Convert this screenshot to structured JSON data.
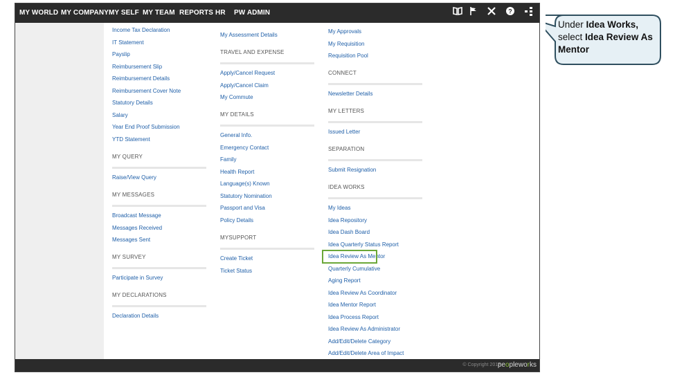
{
  "nav": {
    "items": [
      "MY WORLD",
      "MY COMPANY",
      "MY SELF",
      "MY TEAM",
      "REPORTS",
      "HR",
      "PW ADMIN"
    ],
    "icons": [
      "book-icon",
      "flag-icon",
      "tools-icon",
      "help-icon",
      "menu-dots-icon"
    ]
  },
  "col1": {
    "links_a": [
      "Income Tax Declaration",
      "IT Statement",
      "Payslip",
      "Reimbursement Slip",
      "Reimbursement Details",
      "Reimbursement Cover Note",
      "Statutory Details",
      "Salary",
      "Year End Proof Submission",
      "YTD Statement"
    ],
    "sec_query": "MY QUERY",
    "links_query": [
      "Raise/View Query"
    ],
    "sec_messages": "MY MESSAGES",
    "links_messages": [
      "Broadcast Message",
      "Messages Received",
      "Messages Sent"
    ],
    "sec_survey": "MY SURVEY",
    "links_survey": [
      "Participate in Survey"
    ],
    "sec_declarations": "MY DECLARATIONS",
    "links_declarations": [
      "Declaration Details"
    ]
  },
  "col2": {
    "links_a": [
      "My Assessment Details"
    ],
    "sec_travel": "TRAVEL AND EXPENSE",
    "links_travel": [
      "Apply/Cancel Request",
      "Apply/Cancel Claim",
      "My Commute"
    ],
    "sec_details": "MY DETAILS",
    "links_details": [
      "General Info.",
      "Emergency Contact",
      "Family",
      "Health Report",
      "Language(s) Known",
      "Statutory Nomination",
      "Passport and Visa",
      "Policy Details"
    ],
    "sec_support": "MYSUPPORT",
    "links_support": [
      "Create Ticket",
      "Ticket Status"
    ]
  },
  "col3": {
    "links_a": [
      "My Approvals",
      "My Requisition",
      "Requisition Pool"
    ],
    "sec_connect": "CONNECT",
    "links_connect": [
      "Newsletter Details"
    ],
    "sec_letters": "MY LETTERS",
    "links_letters": [
      "Issued Letter"
    ],
    "sec_separation": "SEPARATION",
    "links_separation": [
      "Submit Resignation"
    ],
    "sec_ideas": "IDEA WORKS",
    "links_ideas": [
      "My Ideas",
      "Idea Repository",
      "Idea Dash Board",
      "Idea Quarterly Status Report",
      "Idea Review As Mentor",
      "Quarterly Cumulative",
      "Aging Report",
      "Idea Review As Coordinator",
      "Idea Mentor Report",
      "Idea Process Report",
      "Idea Review As Administrator",
      "Add/Edit/Delete Category",
      "Add/Edit/Delete Area of Impact"
    ]
  },
  "footer": {
    "copyright": "© Copyright 2017",
    "brand_a": "pe",
    "brand_b": "o",
    "brand_c": "plewo",
    "brand_d": "r",
    "brand_e": "ks"
  },
  "callout": {
    "t1": "Under ",
    "b1": "Idea Works,",
    "t2": " select ",
    "b2": "Idea Review As Mentor"
  }
}
